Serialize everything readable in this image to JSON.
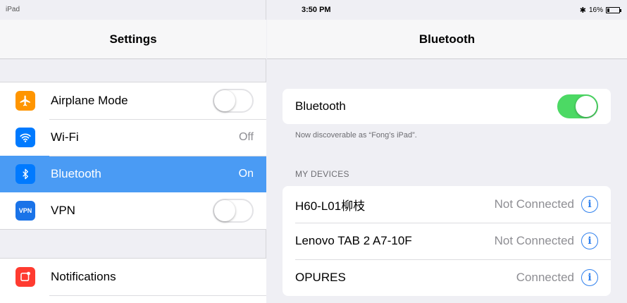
{
  "status_bar": {
    "device": "iPad",
    "time": "3:50 PM",
    "battery_text": "16%",
    "battery_level": 0.16
  },
  "left": {
    "title": "Settings",
    "items": [
      {
        "label": "Airplane Mode",
        "icon": "airplane-icon",
        "color": "#ff9500",
        "control": "toggle",
        "toggle_on": false
      },
      {
        "label": "Wi-Fi",
        "icon": "wifi-icon",
        "color": "#007aff",
        "value": "Off"
      },
      {
        "label": "Bluetooth",
        "icon": "bluetooth-icon",
        "color": "#007aff",
        "value": "On",
        "selected": true
      },
      {
        "label": "VPN",
        "icon": "vpn-icon",
        "color": "#1a73e8",
        "icon_text": "VPN",
        "control": "toggle",
        "toggle_on": false
      }
    ],
    "items2": [
      {
        "label": "Notifications",
        "icon": "notifications-icon",
        "color": "#ff3b30"
      }
    ]
  },
  "right": {
    "title": "Bluetooth",
    "bluetooth_label": "Bluetooth",
    "bluetooth_on": true,
    "discoverable_text": "Now discoverable as “Fong’s iPad”.",
    "section_header": "MY DEVICES",
    "devices": [
      {
        "name": "H60-L01柳枝",
        "status": "Not Connected"
      },
      {
        "name": "Lenovo TAB 2 A7-10F",
        "status": "Not Connected"
      },
      {
        "name": "OPURES",
        "status": "Connected"
      }
    ],
    "accent_color": "#4cd964",
    "info_color": "#2f80ed"
  }
}
